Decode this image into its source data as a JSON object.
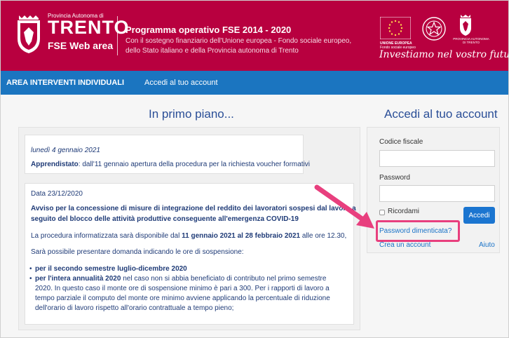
{
  "header": {
    "province_small": "Provincia Autonoma di",
    "province_name": "TRENTO",
    "area_name": "FSE Web area",
    "program_title": "Programma operativo FSE 2014 - 2020",
    "program_desc_1": "Con il sostegno finanziario dell'Unione europea - Fondo sociale europeo,",
    "program_desc_2": "dello Stato italiano e della Provincia autonoma di Trento",
    "ue_label": "UNIONE EUROPEA",
    "ue_sub": "Fondo sociale europeo",
    "provtn_label_1": "PROVINCIA AUTONOMA",
    "provtn_label_2": "DI TRENTO",
    "slogan": "Investiamo nel vostro futuro",
    "logos": [
      "trento-crest-icon",
      "eu-flag-icon",
      "italian-emblem-icon",
      "trento-eagle-icon"
    ]
  },
  "navbar": {
    "section": "AREA INTERVENTI INDIVIDUALI",
    "link": "Accedi al tuo account"
  },
  "news": {
    "title": "In primo piano...",
    "item1": {
      "date": "lunedì 4 gennaio 2021",
      "label": "Apprendistato",
      "text": ": dall'11 gennaio apertura della procedura per la richiesta voucher formativi"
    },
    "item2": {
      "date": "Data 23/12/2020",
      "heading_1": "Avviso per la concessione di misure di integrazione del reddito dei lavoratori sospesi dal lavoro a",
      "heading_2": "seguito del blocco delle attività produttive conseguente all'emergenza COVID-19",
      "p1_a": "La procedura informatizzata sarà disponibile dal ",
      "p1_b": "11 gennaio 2021 al 28 febbraio 2021",
      "p1_c": " alle ore 12.30,",
      "p2": "Sarà possibile presentare domanda indicando le ore di sospensione:",
      "bullet1": "per il secondo semestre luglio-dicembre 2020",
      "bullet2_bold": "per l'intera annualità 2020",
      "bullet2_1": "nel caso non si abbia beneficiato di contributo nel primo semestre",
      "bullet2_2": "2020. In questo caso il monte ore di sospensione minimo è pari a 300.  Per i rapporti di lavoro a",
      "bullet2_3": "tempo parziale il computo del monte ore minimo avviene applicando la percentuale di riduzione",
      "bullet2_4": "dell'orario di lavoro  rispetto all'orario contrattuale a tempo pieno;"
    }
  },
  "login": {
    "title": "Accedi al tuo account",
    "codice_label": "Codice fiscale",
    "codice_value": "",
    "password_label": "Password",
    "password_value": "",
    "remember_label": "Ricordami",
    "submit_label": "Accedi",
    "forgot_link": "Password dimenticata?",
    "create_link": "Crea un account",
    "help_link": "Aiuto"
  },
  "colors": {
    "header_bg": "#b8003f",
    "navbar_bg": "#1b75c0",
    "highlight": "#e83f7e",
    "accent_blue": "#1b75d0"
  }
}
